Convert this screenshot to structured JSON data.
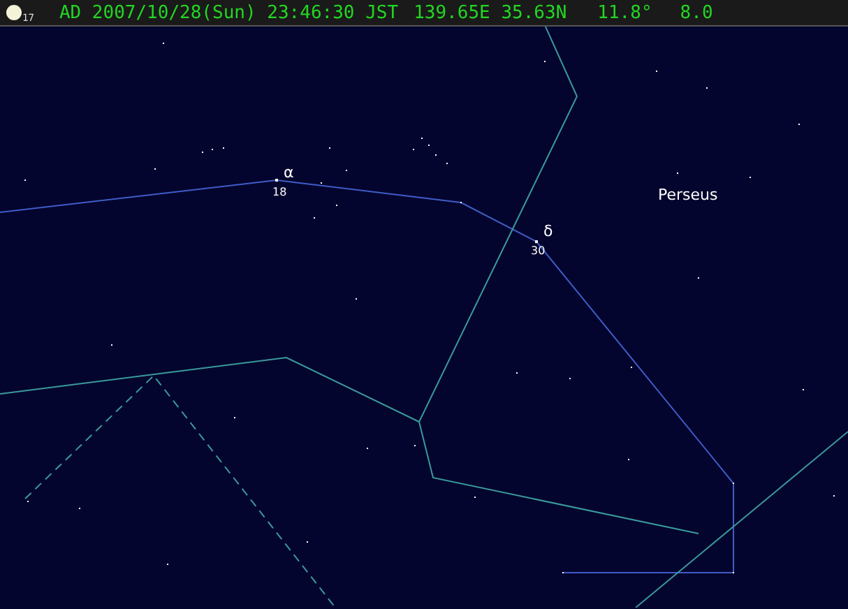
{
  "status_bar": {
    "moon_age": "17",
    "datetime": "AD 2007/10/28(Sun) 23:46:30 JST",
    "coordinates": "139.65E 35.63N",
    "reading_1": "11.8°",
    "reading_2": "8.0"
  },
  "star_labels": [
    {
      "symbol": "α",
      "number": "18"
    },
    {
      "symbol": "δ",
      "number": "30"
    }
  ],
  "constellation_label": "Perseus"
}
